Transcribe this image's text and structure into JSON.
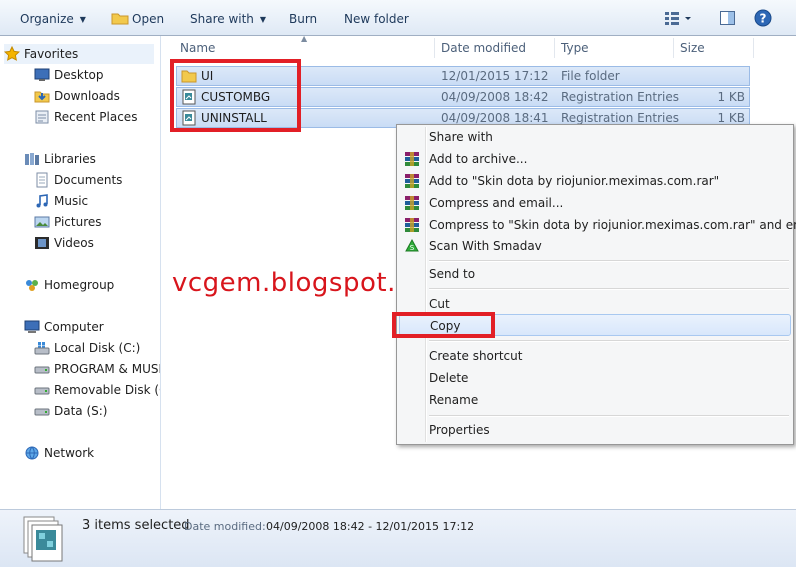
{
  "toolbar": {
    "organize": "Organize",
    "open": "Open",
    "share_with": "Share with",
    "burn": "Burn",
    "new_folder": "New folder"
  },
  "nav": {
    "favorites": "Favorites",
    "desktop": "Desktop",
    "downloads": "Downloads",
    "recent_places": "Recent Places",
    "libraries": "Libraries",
    "documents": "Documents",
    "music": "Music",
    "pictures": "Pictures",
    "videos": "Videos",
    "homegroup": "Homegroup",
    "computer": "Computer",
    "local_disk": "Local Disk (C:)",
    "program_music": "PROGRAM & MUSIC",
    "removable_disk": "Removable Disk (G:)",
    "data_disk": "Data (S:)",
    "network": "Network"
  },
  "columns": {
    "name": "Name",
    "date_modified": "Date modified",
    "type": "Type",
    "size": "Size"
  },
  "files": [
    {
      "name": "UI",
      "date": "12/01/2015 17:12",
      "type": "File folder",
      "size": ""
    },
    {
      "name": "CUSTOMBG",
      "date": "04/09/2008 18:42",
      "type": "Registration Entries",
      "size": "1 KB"
    },
    {
      "name": "UNINSTALL",
      "date": "04/09/2008 18:41",
      "type": "Registration Entries",
      "size": "1 KB"
    }
  ],
  "context_menu": {
    "share_with": "Share with",
    "add_to_archive": "Add to archive...",
    "add_to_rar": "Add to \"Skin dota by riojunior.meximas.com.rar\"",
    "compress_email": "Compress and email...",
    "compress_to_rar_email": "Compress to \"Skin dota by riojunior.meximas.com.rar\" and email",
    "scan_smadav": "Scan With Smadav",
    "send_to": "Send to",
    "cut": "Cut",
    "copy": "Copy",
    "create_shortcut": "Create shortcut",
    "delete": "Delete",
    "rename": "Rename",
    "properties": "Properties"
  },
  "watermark": "vcgem.blogspot.com",
  "status": {
    "count": "3 items selected",
    "date_label": "Date modified:",
    "date_value": "04/09/2008 18:42 - 12/01/2015 17:12"
  },
  "colors": {
    "annotation_red": "#e21f26",
    "selection_blue": "#c9dcf5",
    "toolbar_text": "#1e395b"
  }
}
